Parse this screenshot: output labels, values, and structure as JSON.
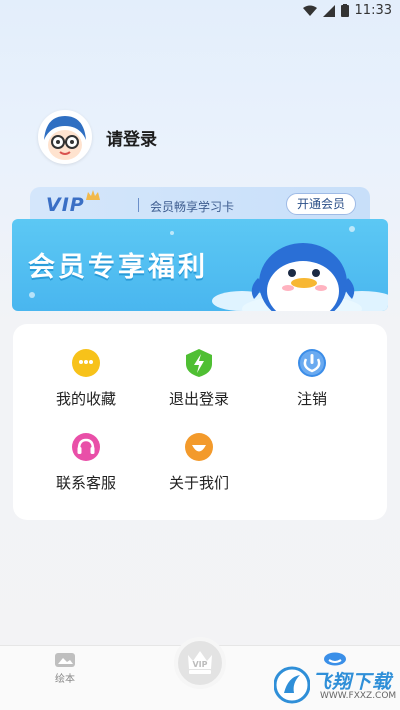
{
  "status_bar": {
    "time": "11:33"
  },
  "profile": {
    "login_label": "请登录"
  },
  "vip_card": {
    "logo": "VIP",
    "description": "会员畅享学习卡",
    "button_label": "开通会员"
  },
  "banner": {
    "title": "会员专享福利"
  },
  "menu": {
    "items": [
      {
        "label": "我的收藏",
        "icon": "chat-bubble-icon",
        "color": "#f7c21a"
      },
      {
        "label": "退出登录",
        "icon": "lightning-shield-icon",
        "color": "#4fbf33"
      },
      {
        "label": "注销",
        "icon": "power-icon",
        "color": "#3b8de8"
      },
      {
        "label": "联系客服",
        "icon": "headset-icon",
        "color": "#e94fa8"
      },
      {
        "label": "关于我们",
        "icon": "smile-icon",
        "color": "#f39a2b"
      }
    ]
  },
  "bottom_nav": {
    "tabs": [
      {
        "label": "绘本",
        "icon": "picture-book-icon"
      },
      {
        "label": "VIP",
        "icon": "vip-crown-icon"
      },
      {
        "label": "",
        "icon": "profile-icon"
      }
    ]
  },
  "watermark": {
    "text": "飞翔下载",
    "url": "WWW.FXXZ.COM"
  },
  "colors": {
    "accent_blue": "#3a6fc5",
    "banner_blue": "#49b6ef",
    "panel_bg": "#ffffff"
  }
}
